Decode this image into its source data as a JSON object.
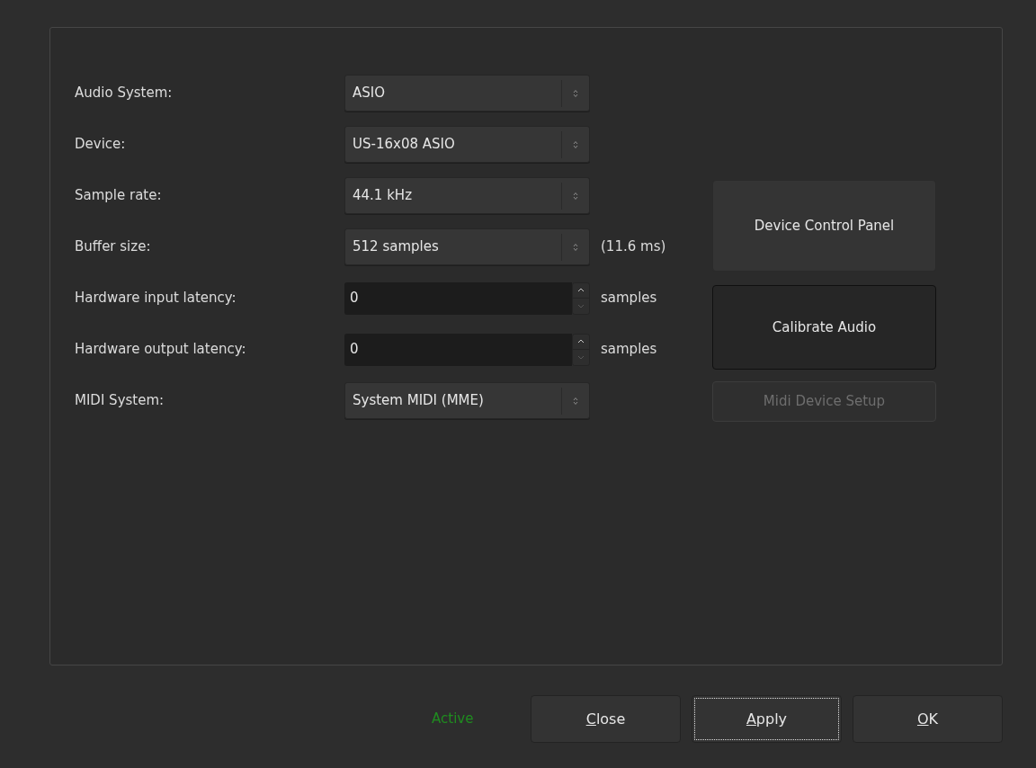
{
  "settings": [
    {
      "label": "Audio System:",
      "kind": "combo",
      "value": "ASIO"
    },
    {
      "label": "Device:",
      "kind": "combo",
      "value": "US-16x08 ASIO"
    },
    {
      "label": "Sample rate:",
      "kind": "combo",
      "value": "44.1 kHz"
    },
    {
      "label": "Buffer size:",
      "kind": "combo",
      "value": "512 samples",
      "unit": "(11.6 ms)"
    },
    {
      "label": "Hardware input latency:",
      "kind": "spin",
      "value": "0",
      "unit": "samples"
    },
    {
      "label": "Hardware output latency:",
      "kind": "spin",
      "value": "0",
      "unit": "samples"
    },
    {
      "label": "MIDI System:",
      "kind": "combo",
      "value": "System MIDI (MME)"
    }
  ],
  "side_buttons": [
    {
      "label": "Device Control Panel",
      "disabled": false,
      "default": false
    },
    {
      "label": "Calibrate Audio",
      "disabled": false,
      "default": true
    },
    {
      "label": "Midi Device Setup",
      "disabled": true,
      "default": false
    }
  ],
  "status": "Active",
  "dialog_buttons": [
    {
      "mnemonic": "C",
      "rest": "lose",
      "focused": false
    },
    {
      "mnemonic": "A",
      "rest": "pply",
      "focused": true
    },
    {
      "mnemonic": "O",
      "rest": "K",
      "focused": false
    }
  ]
}
